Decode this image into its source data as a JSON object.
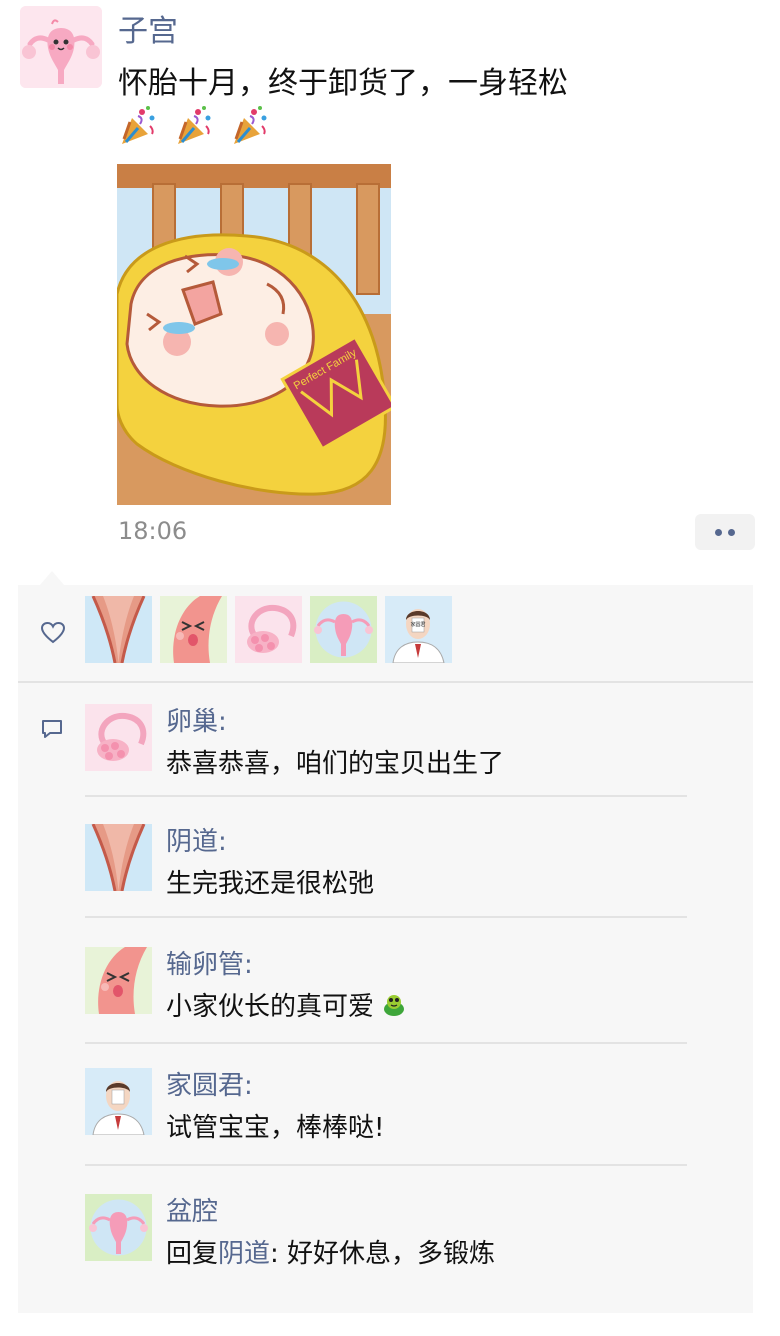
{
  "post": {
    "author": "子宫",
    "avatar": "uterus-avatar",
    "text": "怀胎十月，终于卸货了，一身轻松",
    "emojis": [
      "party-popper-icon",
      "party-popper-icon",
      "party-popper-icon"
    ],
    "image": {
      "subject": "baby-in-yellow-blanket",
      "badge_text": "Perfect Family"
    },
    "time": "18:06"
  },
  "likes": {
    "avatars": [
      "vagina-avatar",
      "fallopian-tube-avatar",
      "ovary-avatar",
      "pelvis-avatar",
      "doctor-avatar"
    ]
  },
  "comments": [
    {
      "name": "卵巢:",
      "text": "恭喜恭喜，咱们的宝贝出生了",
      "avatar": "ovary-avatar"
    },
    {
      "name": "阴道:",
      "text": "生完我还是很松弛",
      "avatar": "vagina-avatar"
    },
    {
      "name": "输卵管:",
      "text": "小家伙长的真可爱",
      "avatar": "fallopian-tube-avatar",
      "emoji": "green-frog-icon"
    },
    {
      "name": "家圆君:",
      "text": "试管宝宝，棒棒哒!",
      "avatar": "doctor-avatar",
      "badge_text": "家圆君"
    },
    {
      "name": "盆腔",
      "reply_prefix": "回复",
      "reply_to": "阴道",
      "reply_colon": ":",
      "text": " 好好休息，多锻炼",
      "avatar": "pelvis-avatar"
    }
  ],
  "colors": {
    "link": "#56688f",
    "panel_bg": "#f7f7f7",
    "divider": "#e3e3e3",
    "time": "#8c8c8c"
  }
}
